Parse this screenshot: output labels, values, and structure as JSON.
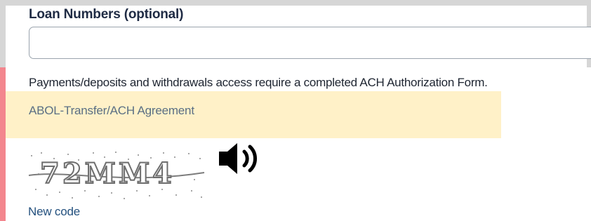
{
  "form": {
    "loan_numbers_label": "Loan Numbers (optional)",
    "loan_numbers_value": "",
    "ach_notice": "Payments/deposits and withdrawals access require a completed ACH Authorization Form.",
    "agreement_link": "ABOL-Transfer/ACH Agreement"
  },
  "captcha": {
    "code_text": "72MM4",
    "new_code_label": "New code",
    "audio_icon": "speaker-icon"
  },
  "colors": {
    "highlight_bg": "#fff1c8",
    "link": "#23507e",
    "left_accent": "#f3868e"
  }
}
